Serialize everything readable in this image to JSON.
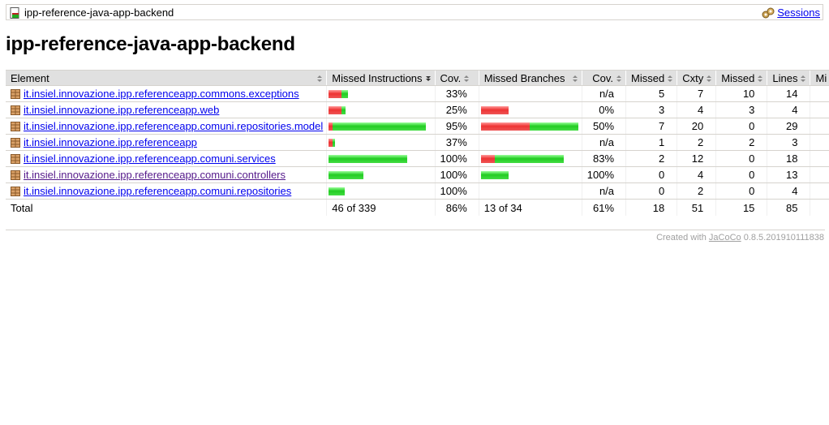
{
  "breadcrumb": {
    "title": "ipp-reference-java-app-backend",
    "sessions_label": "Sessions"
  },
  "page_title": "ipp-reference-java-app-backend",
  "columns": [
    "Element",
    "Missed Instructions",
    "Cov.",
    "Missed Branches",
    "Cov.",
    "Missed",
    "Cxty",
    "Missed",
    "Lines",
    "Mi"
  ],
  "rows": [
    {
      "name": "it.insiel.innovazione.ipp.referenceapp.commons.exceptions",
      "visited": false,
      "instr_red": 0.133,
      "instr_green": 0.067,
      "instr_cov": "33%",
      "branch_red": 0,
      "branch_green": 0,
      "branch_cov": "n/a",
      "cxty_missed": "5",
      "cxty": "7",
      "lines_missed": "10",
      "lines": "14"
    },
    {
      "name": "it.insiel.innovazione.ipp.referenceapp.web",
      "visited": false,
      "instr_red": 0.133,
      "instr_green": 0.042,
      "instr_cov": "25%",
      "branch_red": 0.283,
      "branch_green": 0,
      "branch_cov": "0%",
      "cxty_missed": "3",
      "cxty": "4",
      "lines_missed": "3",
      "lines": "4"
    },
    {
      "name": "it.insiel.innovazione.ipp.referenceapp.comuni.repositories.model",
      "visited": false,
      "instr_red": 0.042,
      "instr_green": 0.958,
      "instr_cov": "95%",
      "branch_red": 0.5,
      "branch_green": 0.5,
      "branch_cov": "50%",
      "cxty_missed": "7",
      "cxty": "20",
      "lines_missed": "0",
      "lines": "29"
    },
    {
      "name": "it.insiel.innovazione.ipp.referenceapp",
      "visited": false,
      "instr_red": 0.042,
      "instr_green": 0.025,
      "instr_cov": "37%",
      "branch_red": 0,
      "branch_green": 0,
      "branch_cov": "n/a",
      "cxty_missed": "1",
      "cxty": "2",
      "lines_missed": "2",
      "lines": "3"
    },
    {
      "name": "it.insiel.innovazione.ipp.referenceapp.comuni.services",
      "visited": false,
      "instr_red": 0,
      "instr_green": 0.808,
      "instr_cov": "100%",
      "branch_red": 0.142,
      "branch_green": 0.708,
      "branch_cov": "83%",
      "cxty_missed": "2",
      "cxty": "12",
      "lines_missed": "0",
      "lines": "18"
    },
    {
      "name": "it.insiel.innovazione.ipp.referenceapp.comuni.controllers",
      "visited": true,
      "instr_red": 0,
      "instr_green": 0.358,
      "instr_cov": "100%",
      "branch_red": 0,
      "branch_green": 0.283,
      "branch_cov": "100%",
      "cxty_missed": "0",
      "cxty": "4",
      "lines_missed": "0",
      "lines": "13"
    },
    {
      "name": "it.insiel.innovazione.ipp.referenceapp.comuni.repositories",
      "visited": false,
      "instr_red": 0,
      "instr_green": 0.167,
      "instr_cov": "100%",
      "branch_red": 0,
      "branch_green": 0,
      "branch_cov": "n/a",
      "cxty_missed": "0",
      "cxty": "2",
      "lines_missed": "0",
      "lines": "4"
    }
  ],
  "total": {
    "label": "Total",
    "instr": "46 of 339",
    "instr_cov": "86%",
    "branch": "13 of 34",
    "branch_cov": "61%",
    "cxty_missed": "18",
    "cxty": "51",
    "lines_missed": "15",
    "lines": "85"
  },
  "footer": {
    "prefix": "Created with ",
    "link": "JaCoCo",
    "version": " 0.8.5.201910111838"
  },
  "colors": {
    "red": "#ee3333",
    "green": "#22cc22",
    "header_bg": "#e0e0e0"
  }
}
